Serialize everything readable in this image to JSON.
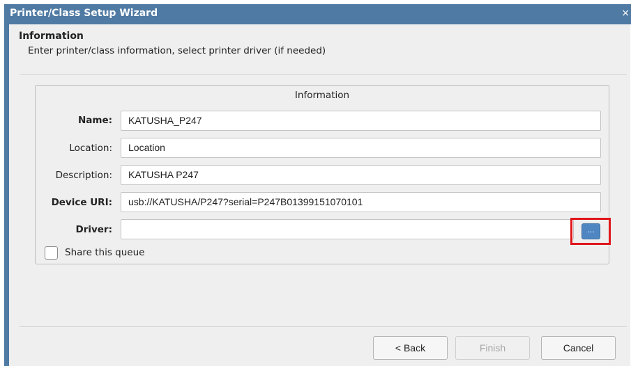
{
  "window": {
    "title": "Printer/Class Setup Wizard",
    "close_glyph": "×"
  },
  "page": {
    "title": "Information",
    "subtitle": "Enter printer/class information, select printer driver (if needed)"
  },
  "group": {
    "title": "Information",
    "fields": {
      "name": {
        "label": "Name:",
        "value": "KATUSHA_P247"
      },
      "location": {
        "label": "Location:",
        "value": "Location"
      },
      "description": {
        "label": "Description:",
        "value": "KATUSHA P247"
      },
      "device_uri": {
        "label": "Device URI:",
        "value": "usb://KATUSHA/P247?serial=P247B01399151070101"
      },
      "driver": {
        "label": "Driver:",
        "value": ""
      }
    },
    "browse_label": "...",
    "share_label": "Share this queue",
    "share_checked": false
  },
  "buttons": {
    "back": "< Back",
    "finish": "Finish",
    "cancel": "Cancel"
  },
  "colors": {
    "titlebar": "#4f7aa3",
    "highlight": "#e0161b",
    "browse_button": "#4f86c2"
  }
}
